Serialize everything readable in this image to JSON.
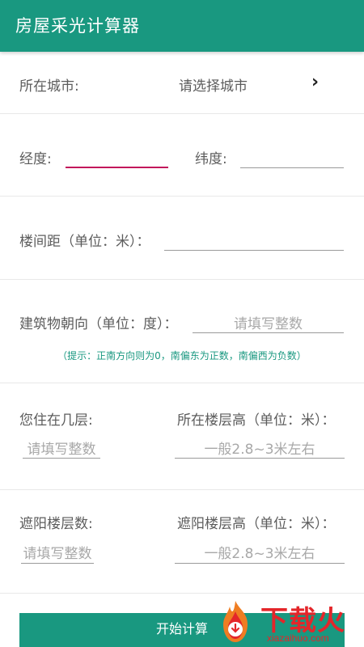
{
  "app": {
    "title": "房屋采光计算器"
  },
  "city": {
    "label": "所在城市:",
    "value": "请选择城市",
    "chevron": "›"
  },
  "coords": {
    "lon_label": "经度:",
    "lat_label": "纬度:"
  },
  "distance": {
    "label": "楼间距（单位：米）："
  },
  "orientation": {
    "label": "建筑物朝向（单位：度）：",
    "placeholder": "请填写整数",
    "hint": "（提示：正南方向则为0，南偏东为正数，南偏西为负数）"
  },
  "floor": {
    "label": "您住在几层:",
    "placeholder": "请填写整数",
    "height_label": "所在楼层高（单位：米）：",
    "height_placeholder": "一般2.8~3米左右"
  },
  "shade": {
    "label": "遮阳楼层数:",
    "placeholder": "请填写整数",
    "height_label": "遮阳楼层高（单位：米）：",
    "height_placeholder": "一般2.8~3米左右"
  },
  "action": {
    "button_label": "开始计算"
  },
  "watermark": {
    "cn": "下载火",
    "en": "xiazaihuo.com"
  },
  "colors": {
    "primary": "#199880",
    "focus_line": "#c2185b",
    "watermark": "#e4262a"
  }
}
